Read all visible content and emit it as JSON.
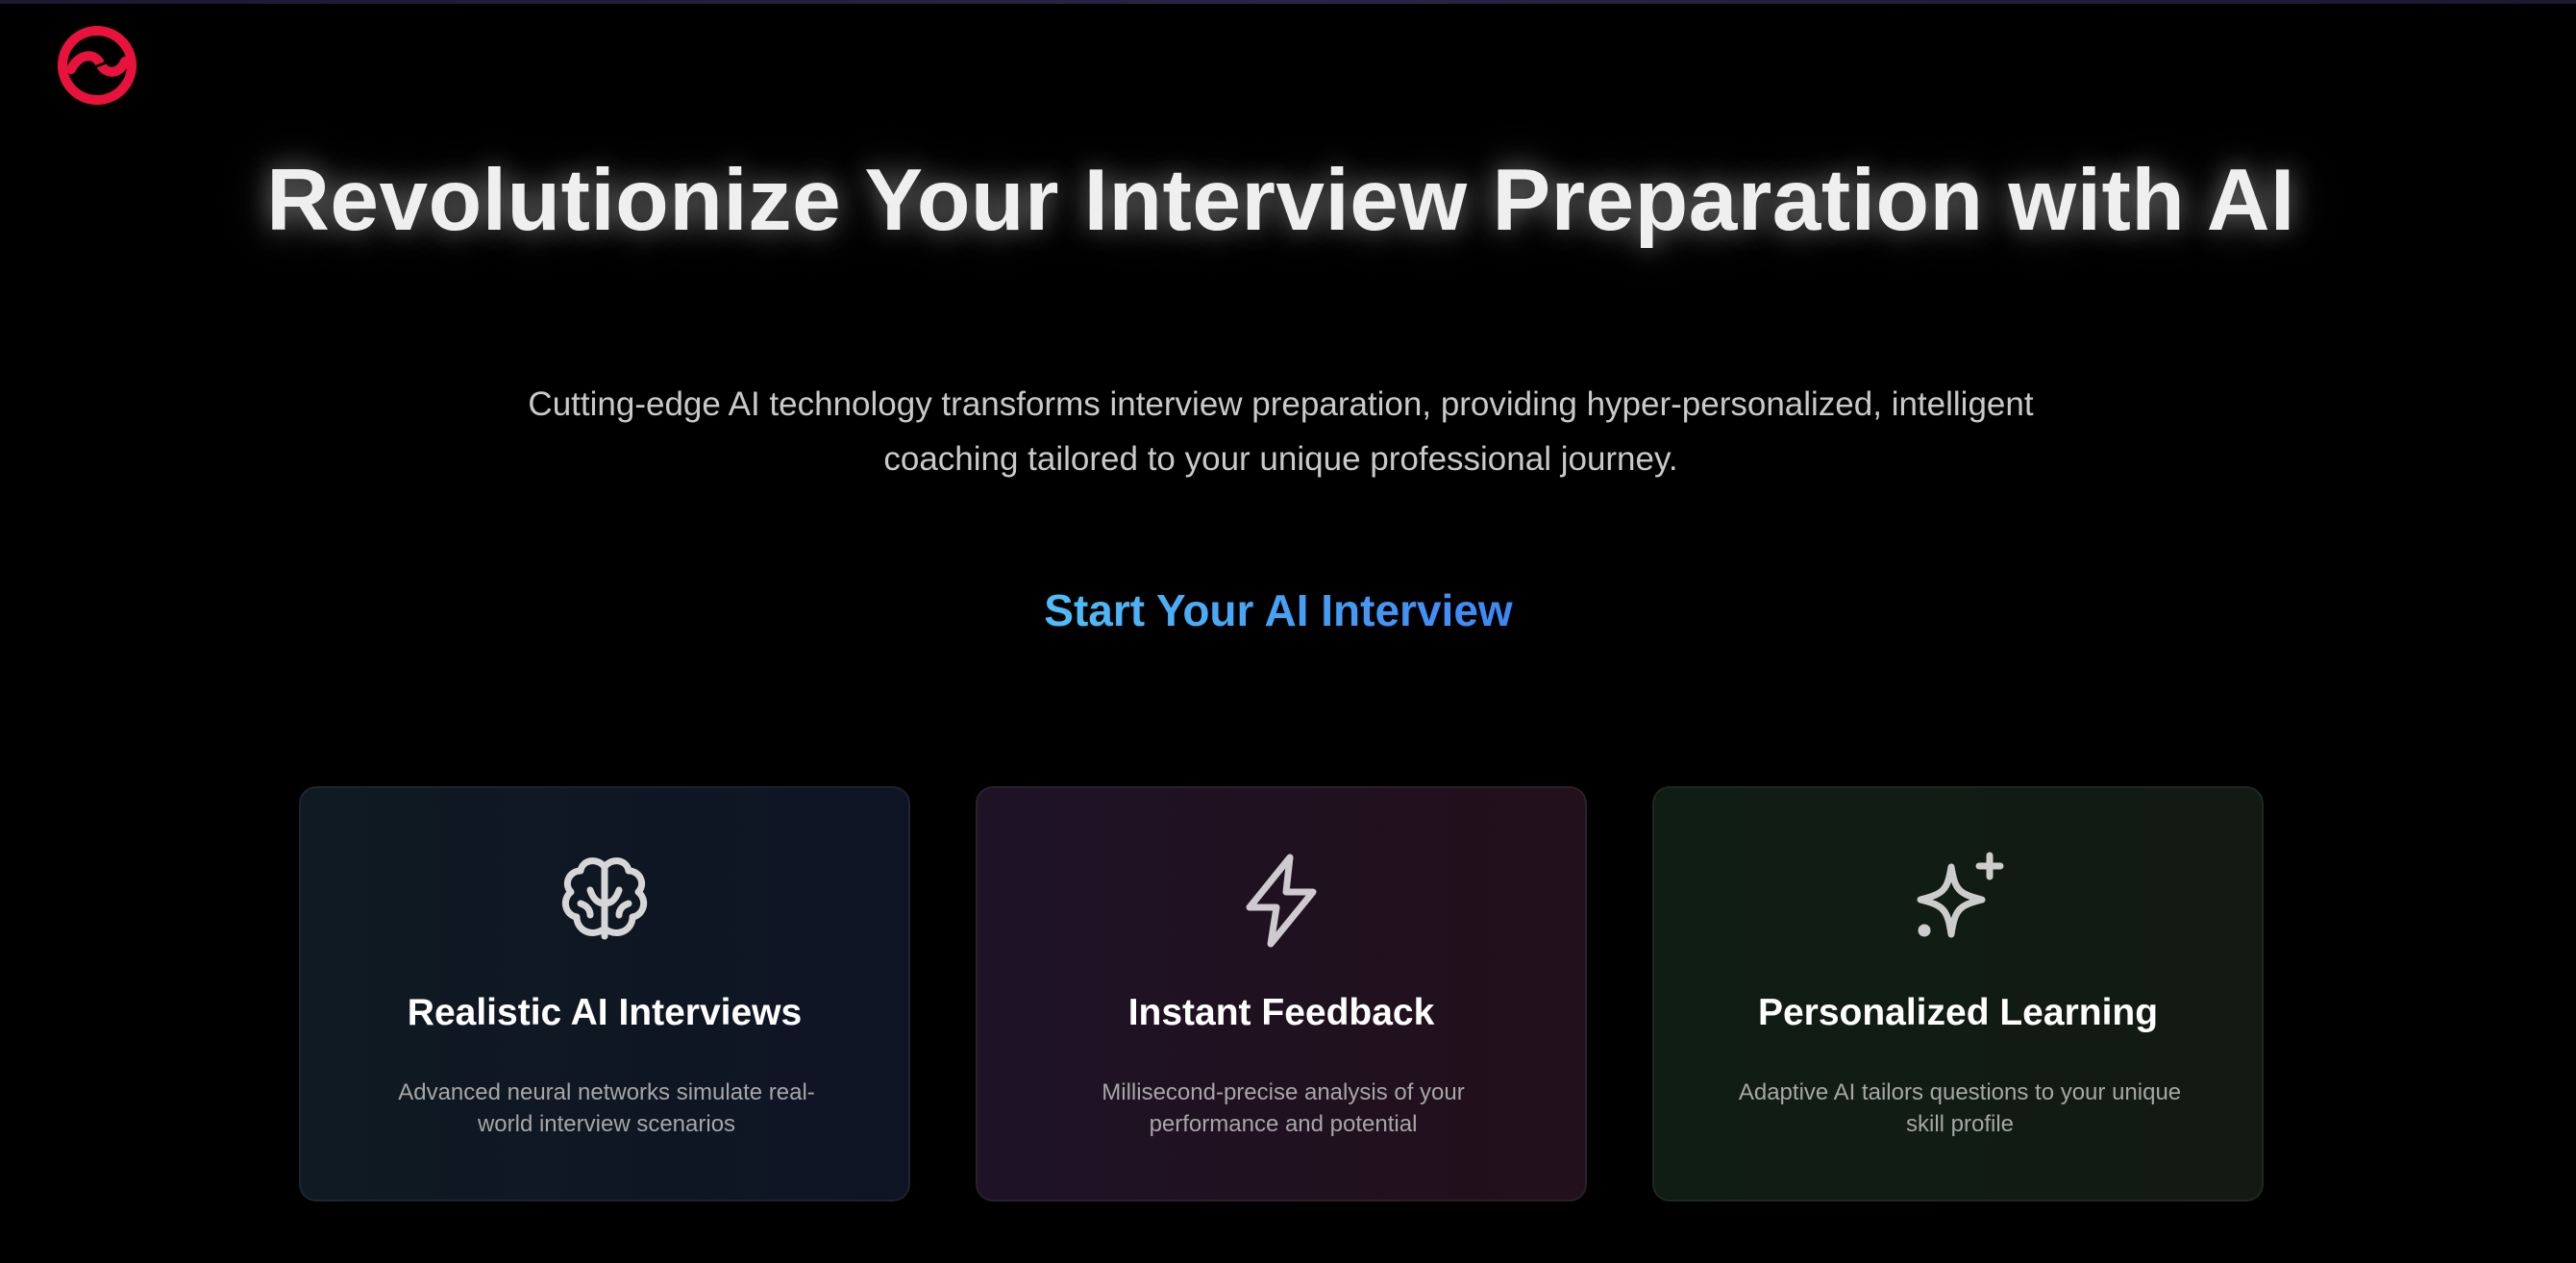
{
  "app": {
    "logo_icon": "brand-ring-logo",
    "logo_color": "#e8123c"
  },
  "hero": {
    "title": "Revolutionize Your Interview Preparation with AI",
    "subtitle": "Cutting-edge AI technology transforms interview preparation, providing hyper-personalized, intelligent coaching tailored to your unique professional journey."
  },
  "cta": {
    "label": "Start Your AI Interview",
    "gradient_start": "#4fc3f7",
    "gradient_end": "#3b82f6"
  },
  "features": [
    {
      "icon": "brain-icon",
      "title": "Realistic AI Interviews",
      "description": "Advanced neural networks simulate real-world interview scenarios"
    },
    {
      "icon": "lightning-icon",
      "title": "Instant Feedback",
      "description": "Millisecond-precise analysis of your performance and potential"
    },
    {
      "icon": "sparkles-icon",
      "title": "Personalized Learning",
      "description": "Adaptive AI tailors questions to your unique skill profile"
    }
  ]
}
